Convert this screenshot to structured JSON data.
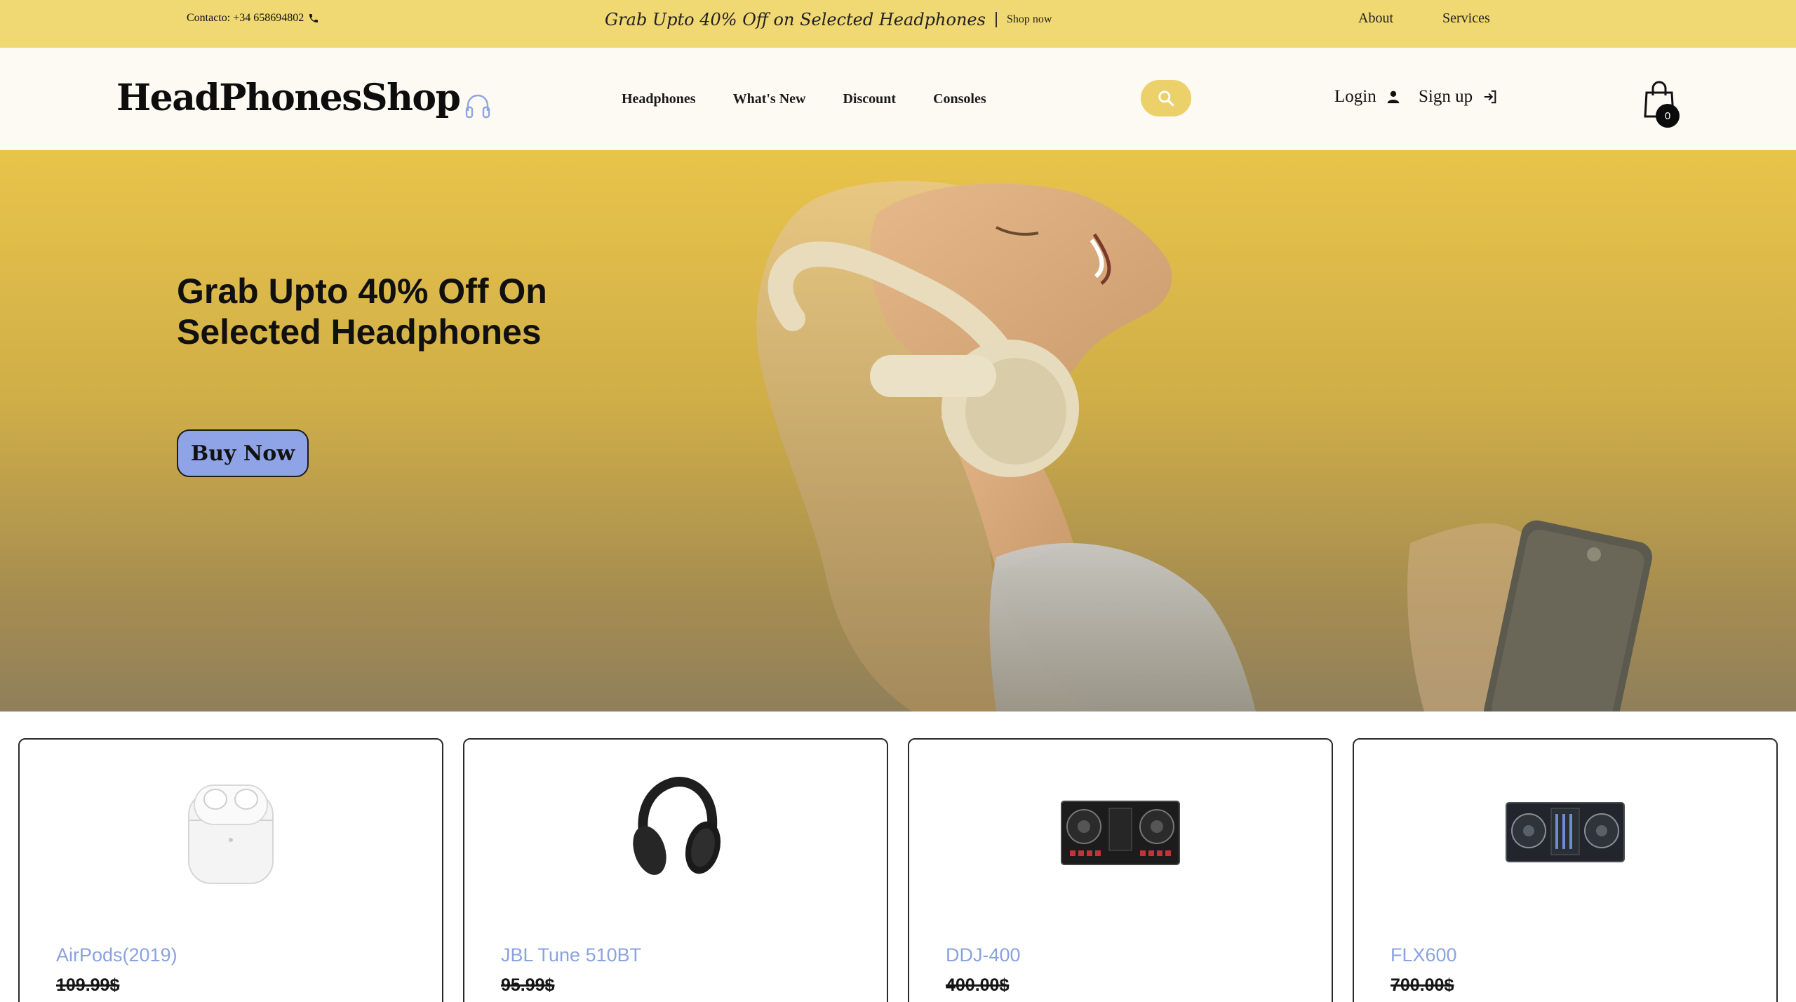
{
  "topbar": {
    "contact": "Contacto: +34 658694802",
    "promo": "Grab Upto 40% Off on Selected Headphones",
    "shop_now": "Shop now",
    "about": "About",
    "services": "Services"
  },
  "header": {
    "logo": "HeadPhonesShop",
    "nav": [
      "Headphones",
      "What's New",
      "Discount",
      "Consoles"
    ],
    "login": "Login",
    "signup": "Sign up",
    "cart_count": "0"
  },
  "hero": {
    "title": "Grab Upto 40% Off On Selected Headphones",
    "cta": "Buy Now"
  },
  "products": [
    {
      "name": "AirPods(2019)",
      "price": "109.99$",
      "icon": "airpods-image"
    },
    {
      "name": "JBL Tune 510BT",
      "price": "95.99$",
      "icon": "headphones-image"
    },
    {
      "name": "DDJ-400",
      "price": "400.00$",
      "icon": "dj-controller-image"
    },
    {
      "name": "FLX600",
      "price": "700.00$",
      "icon": "dj-controller-image"
    }
  ],
  "colors": {
    "topbar": "#f0d872",
    "header": "#fdfaf4",
    "accent_yellow": "#ecd06a",
    "button_blue": "#8fa4e6",
    "product_name": "#8aa2e0"
  }
}
